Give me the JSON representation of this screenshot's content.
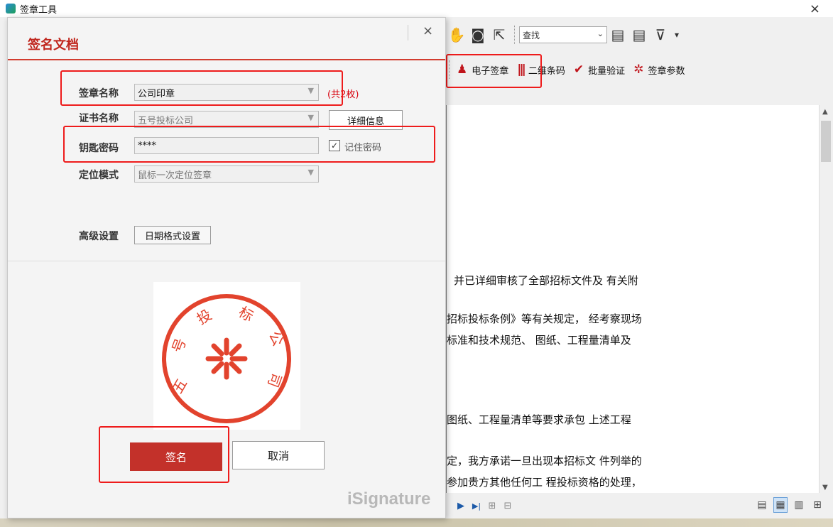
{
  "window": {
    "title": "签章工具",
    "close": "×"
  },
  "toolbar1": {
    "hand_icon": "✋",
    "snapshot_icon": "◙",
    "select_icon": "⇱",
    "search_placeholder": "查找",
    "search_dropdown": "⌄",
    "prev_result_icon": "▤",
    "next_result_icon": "▤",
    "filter_icon": "⊽",
    "filter_dropdown": "▾"
  },
  "toolbar2": {
    "esign_label": "电子签章",
    "esign_icon": "♟",
    "qrcode_label": "二维条码",
    "qrcode_icon": "|||",
    "batch_verify_label": "批量验证",
    "batch_verify_icon": "✔",
    "sign_params_label": "签章参数",
    "sign_params_icon": "✲"
  },
  "document": {
    "lines": [
      "并已详细审核了全部招标文件及 有关附",
      "招标投标条例》等有关规定， 经考察现场",
      "标准和技术规范、 图纸、工程量清单及",
      "图纸、工程量清单等要求承包 上述工程",
      "定，我方承诺一旦出现本招标文 件列举的",
      "参加贵方其他任何工 程投标资格的处理，"
    ]
  },
  "bottombar": {
    "next_icon": "▶",
    "last_icon": "▶|",
    "bookmark_icon": "⊞",
    "bookmark2_icon": "⊟",
    "view_single_icon": "▤",
    "view_continuous_icon": "▦",
    "view_double_icon": "▥",
    "view_fourth_icon": "⊞"
  },
  "dialog": {
    "title": "签名文档",
    "close": "×",
    "seal_name_label": "签章名称",
    "seal_name_value": "公司印章",
    "seal_count": "(共2枚)",
    "cert_name_label": "证书名称",
    "cert_name_value": "五号投标公司",
    "details_button": "详细信息",
    "key_password_label": "钥匙密码",
    "key_password_value": "****",
    "remember_password_label": "记住密码",
    "remember_password_check": "✓",
    "position_mode_label": "定位模式",
    "position_mode_value": "鼠标一次定位签章",
    "advanced_label": "高级设置",
    "date_format_button": "日期格式设置",
    "dropdown_arrow": "▼",
    "sign_button": "签名",
    "cancel_button": "取消",
    "watermark": "iSignature"
  },
  "seal": {
    "color": "#e2432d",
    "chars": [
      "五",
      "号",
      "投",
      "标",
      "公",
      "司"
    ]
  }
}
